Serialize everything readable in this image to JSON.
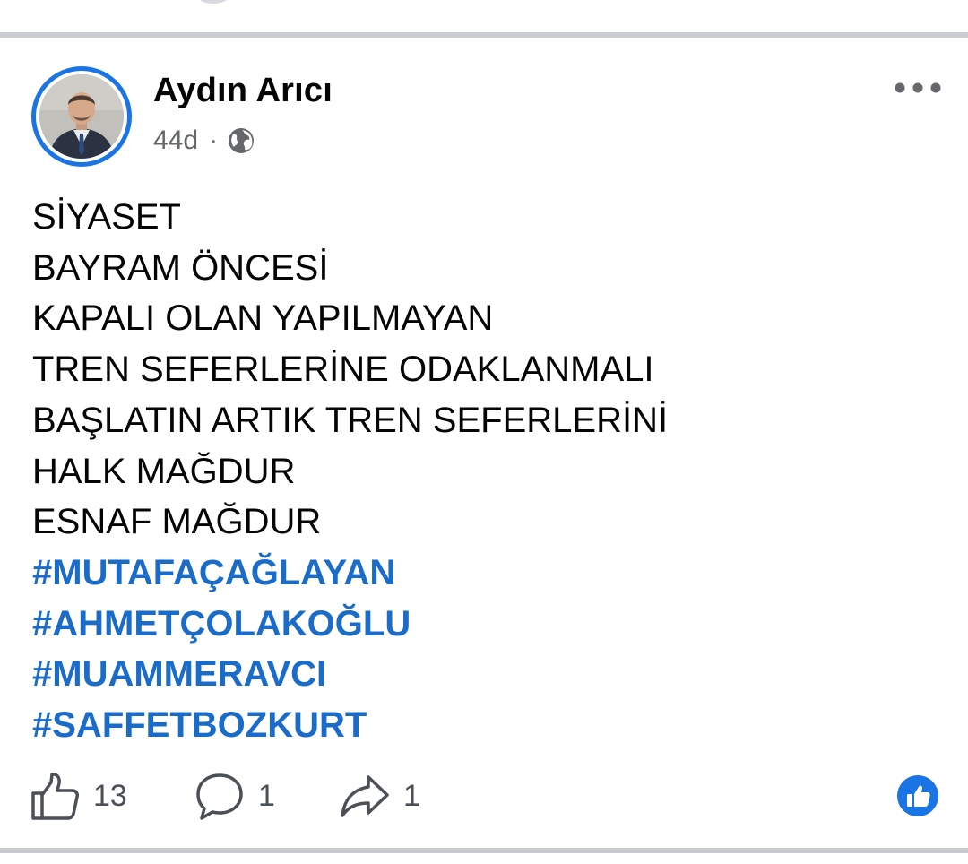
{
  "post": {
    "author": "Aydın Arıcı",
    "timestamp": "44d",
    "separator": "·",
    "audience_icon": "globe-icon",
    "body_lines": [
      "SİYASET",
      "BAYRAM ÖNCESİ",
      "KAPALI OLAN YAPILMAYAN",
      "TREN SEFERLERİNE ODAKLANMALI",
      "BAŞLATIN ARTIK TREN SEFERLERİNİ",
      "HALK MAĞDUR",
      "ESNAF MAĞDUR"
    ],
    "hashtags": [
      "#MUTAFAÇAĞLAYAN",
      "#AHMETÇOLAKOĞLU",
      "#MUAMMERAVCI",
      "#SAFFETBOZKURT"
    ]
  },
  "actions": {
    "like_count": "13",
    "comment_count": "1",
    "share_count": "1"
  },
  "colors": {
    "accent_blue": "#1b74e4",
    "hashtag_blue": "#1b6bc9",
    "text_primary": "#050505",
    "text_secondary": "#65676b",
    "divider": "#c9ccd1"
  }
}
